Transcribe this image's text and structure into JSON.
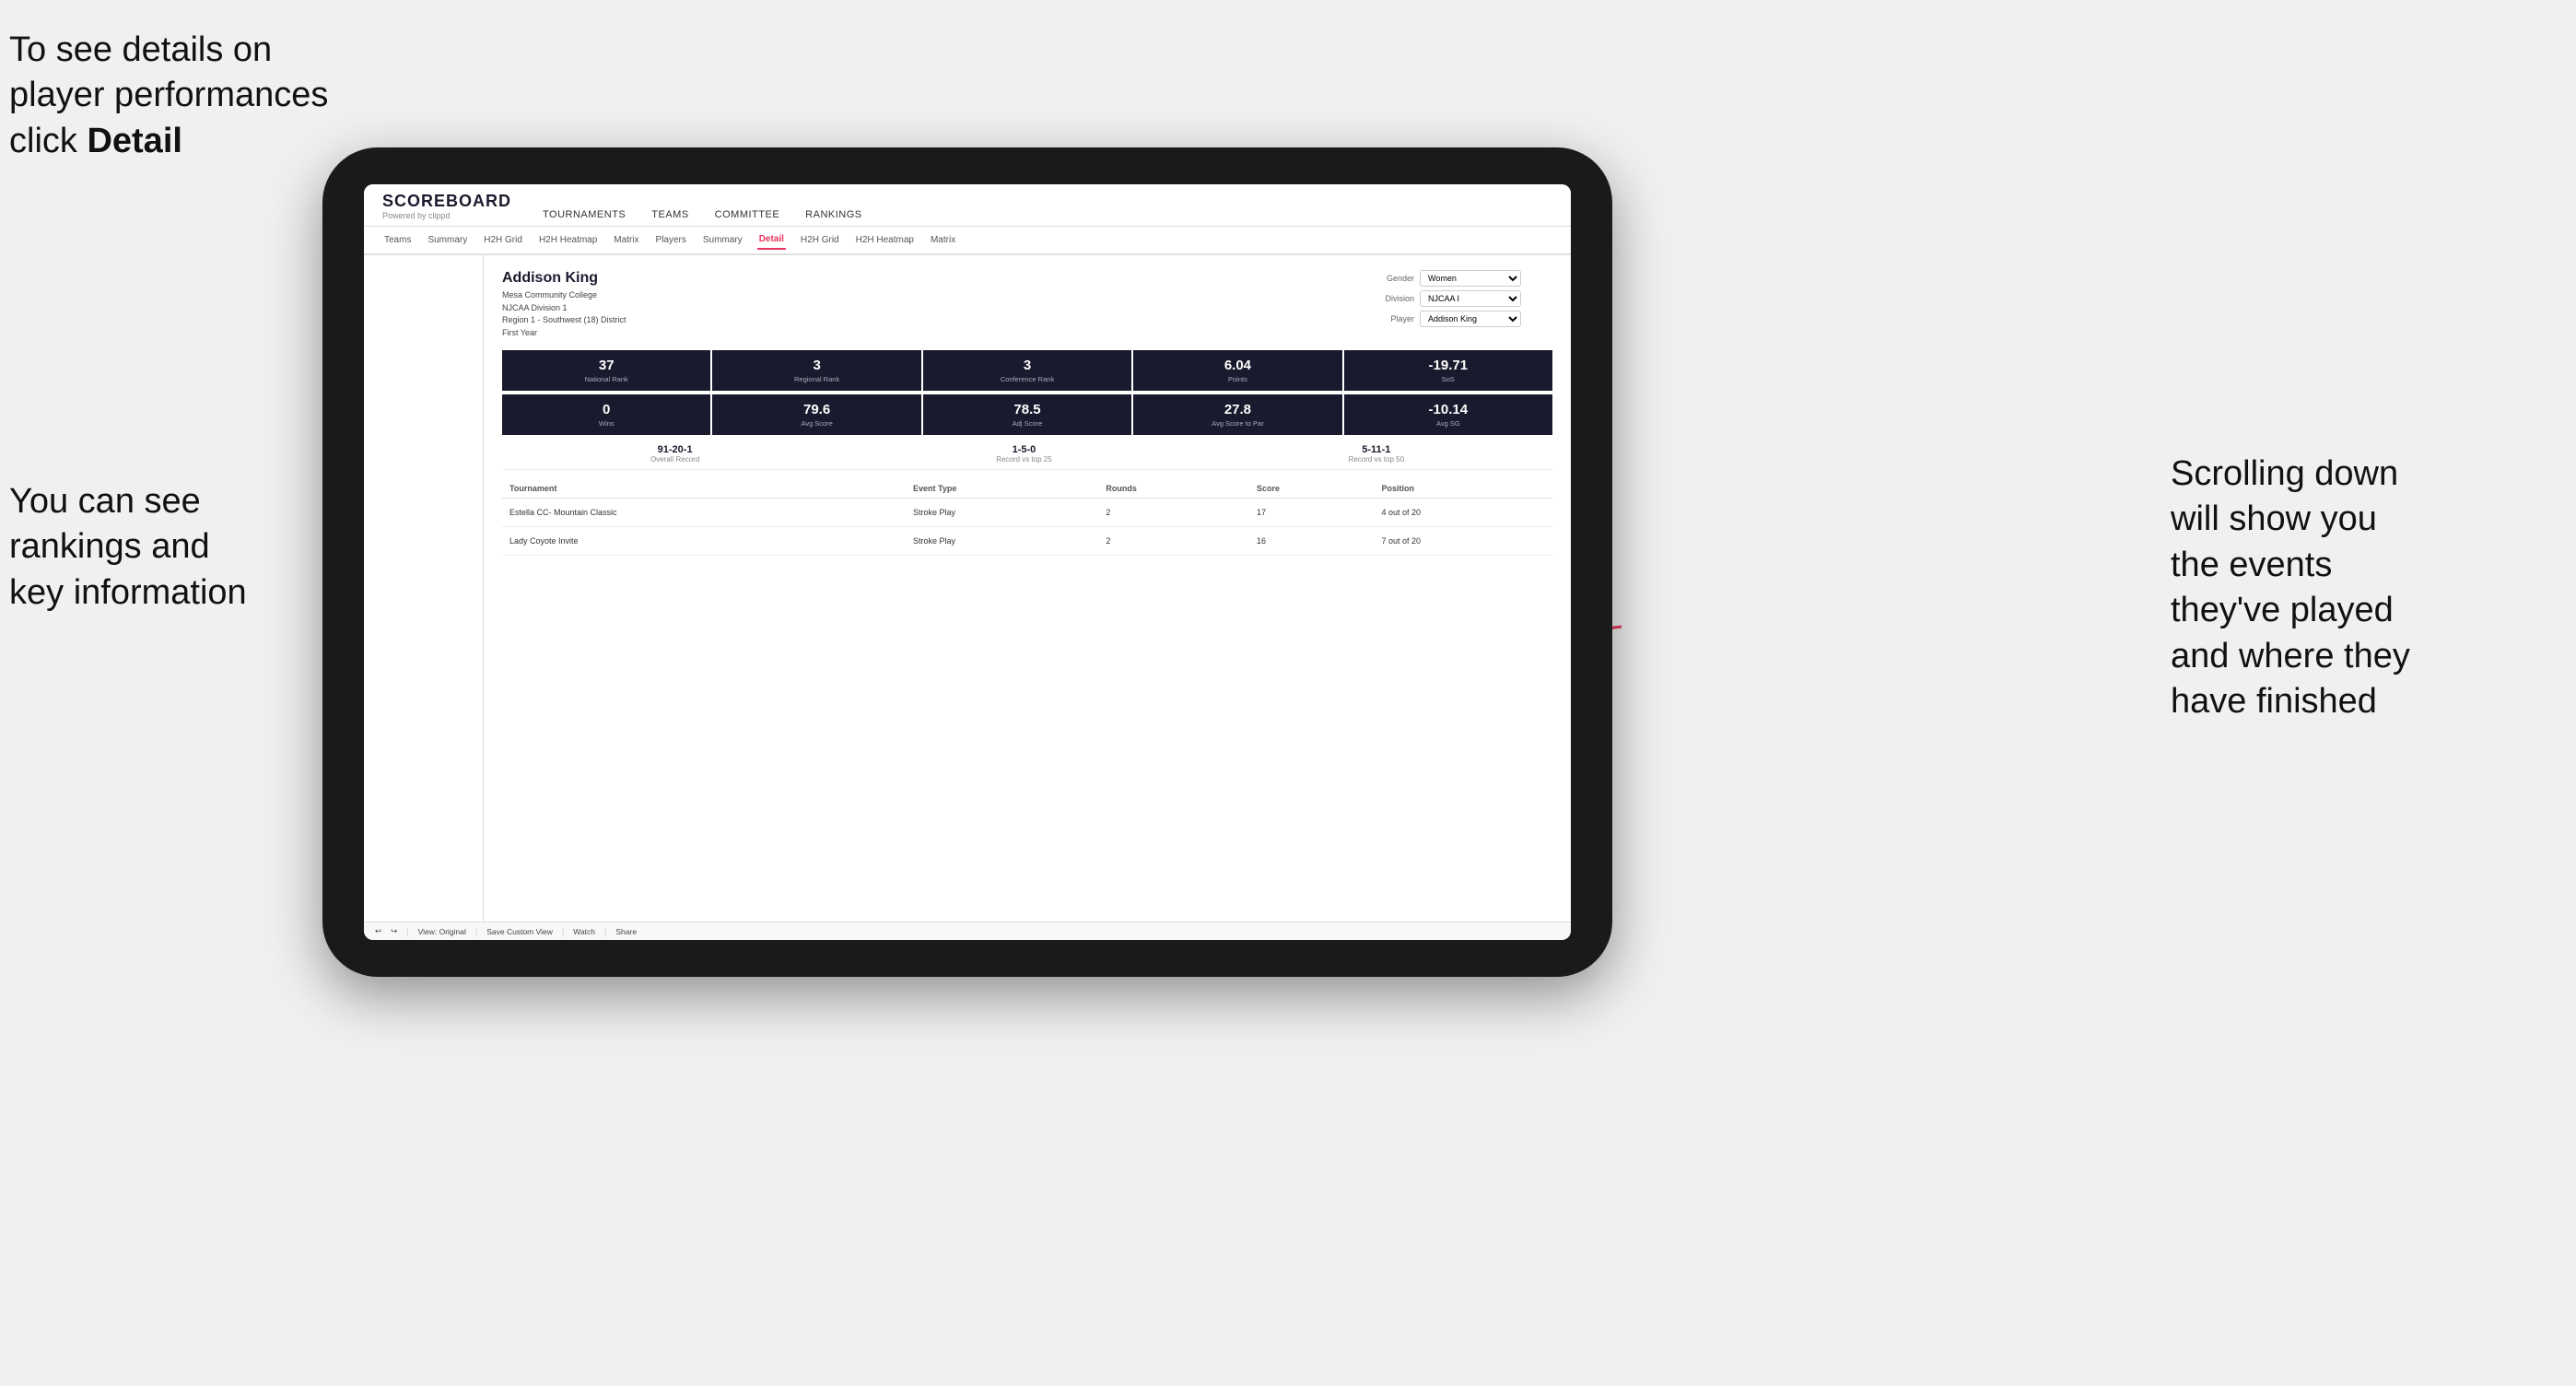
{
  "annotations": {
    "top_left": "To see details on player performances click ",
    "top_left_bold": "Detail",
    "bottom_left_line1": "You can see",
    "bottom_left_line2": "rankings and",
    "bottom_left_line3": "key information",
    "right_line1": "Scrolling down",
    "right_line2": "will show you",
    "right_line3": "the events",
    "right_line4": "they've played",
    "right_line5": "and where they",
    "right_line6": "have finished"
  },
  "nav": {
    "logo": "SCOREBOARD",
    "logo_sub": "Powered by clippd",
    "main_items": [
      "TOURNAMENTS",
      "TEAMS",
      "COMMITTEE",
      "RANKINGS"
    ],
    "sub_items": [
      "Teams",
      "Summary",
      "H2H Grid",
      "H2H Heatmap",
      "Matrix",
      "Players",
      "Summary",
      "Detail",
      "H2H Grid",
      "H2H Heatmap",
      "Matrix"
    ],
    "active_sub": "Detail"
  },
  "player": {
    "name": "Addison King",
    "school": "Mesa Community College",
    "division": "NJCAA Division 1",
    "region": "Region 1 - Southwest (18) District",
    "year": "First Year"
  },
  "selectors": {
    "gender_label": "Gender",
    "gender_value": "Women",
    "division_label": "Division",
    "division_value": "NJCAA I",
    "player_label": "Player",
    "player_value": "Addison King"
  },
  "stats_row1": [
    {
      "value": "37",
      "label": "National Rank"
    },
    {
      "value": "3",
      "label": "Regional Rank"
    },
    {
      "value": "3",
      "label": "Conference Rank"
    },
    {
      "value": "6.04",
      "label": "Points"
    },
    {
      "value": "-19.71",
      "label": "SoS"
    }
  ],
  "stats_row2": [
    {
      "value": "0",
      "label": "Wins"
    },
    {
      "value": "79.6",
      "label": "Avg Score"
    },
    {
      "value": "78.5",
      "label": "Adj Score"
    },
    {
      "value": "27.8",
      "label": "Avg Score to Par"
    },
    {
      "value": "-10.14",
      "label": "Avg SG"
    }
  ],
  "records": [
    {
      "value": "91-20-1",
      "label": "Overall Record"
    },
    {
      "value": "1-5-0",
      "label": "Record vs top 25"
    },
    {
      "value": "5-11-1",
      "label": "Record vs top 50"
    }
  ],
  "table_headers": [
    "Tournament",
    "Event Type",
    "Rounds",
    "Score",
    "Position"
  ],
  "tournaments": [
    {
      "name": "Estella CC- Mountain Classic",
      "type": "Stroke Play",
      "rounds": "2",
      "score": "17",
      "position": "4 out of 20"
    },
    {
      "name": "Lady Coyote Invite",
      "type": "Stroke Play",
      "rounds": "2",
      "score": "16",
      "position": "7 out of 20"
    }
  ],
  "toolbar": {
    "view_label": "View: Original",
    "save_label": "Save Custom View",
    "watch_label": "Watch",
    "share_label": "Share"
  }
}
